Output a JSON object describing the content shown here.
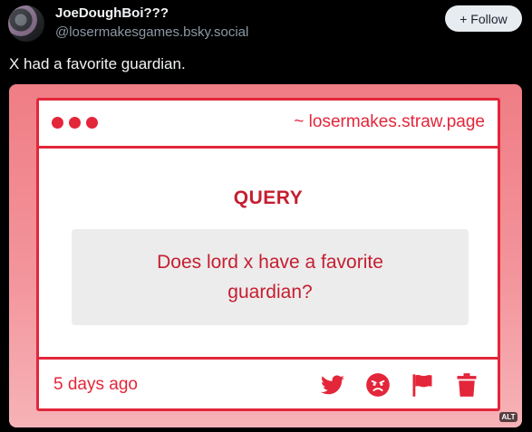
{
  "author": {
    "display_name": "JoeDoughBoi???",
    "handle": "@losermakesgames.bsky.social",
    "follow_label": "+ Follow"
  },
  "post": {
    "text": "X had a favorite guardian."
  },
  "embed": {
    "url_text": "~ losermakes.straw.page",
    "query_title": "QUERY",
    "question": "Does lord x have a favorite guardian?",
    "time_ago": "5 days ago",
    "alt_badge": "ALT",
    "footer_icons": [
      "twitter-bird-icon",
      "angry-face-icon",
      "flag-icon",
      "trash-icon"
    ]
  },
  "colors": {
    "page_background": "#000000",
    "accent_red": "#e3263a",
    "card_gradient_top": "#f07d85",
    "card_gradient_bottom": "#f6b3b7",
    "question_box": "#ececec"
  }
}
